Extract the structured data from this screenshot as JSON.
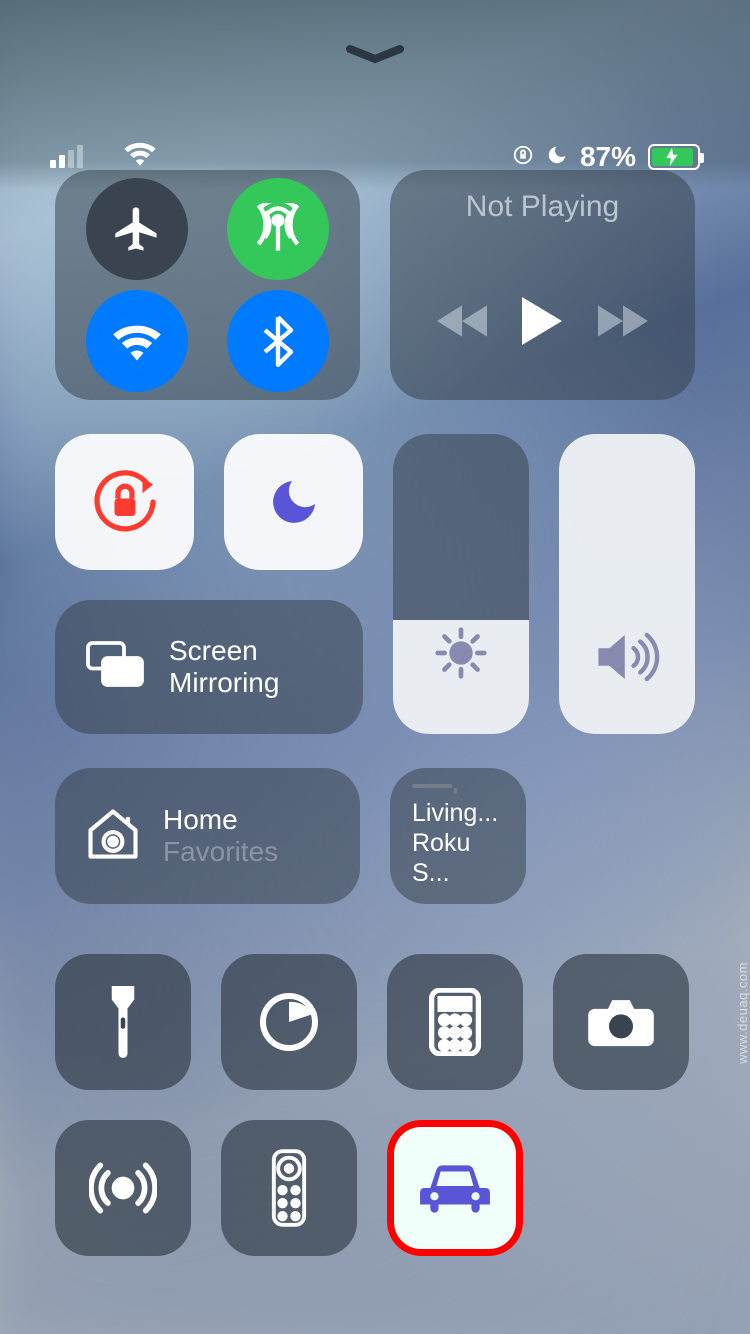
{
  "status": {
    "signal_bars_filled": 2,
    "signal_bars_total": 4,
    "orientation_lock": "on",
    "dnd": "on",
    "battery_pct": "87%",
    "battery_charging": true
  },
  "media": {
    "title": "Not Playing"
  },
  "toggles": {
    "orientation_lock_active": true,
    "dnd_active": true
  },
  "screen_mirroring": {
    "line1": "Screen",
    "line2": "Mirroring"
  },
  "sliders": {
    "brightness_pct": 38,
    "volume_pct": 100
  },
  "home": {
    "primary": "Home",
    "secondary": "Favorites"
  },
  "device": {
    "line1": "Living...",
    "line2": "Roku S..."
  },
  "icons": {
    "airplane": "airplane",
    "cellular": "cellular-data",
    "wifi": "wifi",
    "bluetooth": "bluetooth",
    "flashlight": "flashlight",
    "timer": "timer",
    "calculator": "calculator",
    "camera": "camera",
    "nfc": "nfc-reader",
    "remote": "apple-tv-remote",
    "car": "driving-mode"
  },
  "watermark": "www.deuaq.com"
}
